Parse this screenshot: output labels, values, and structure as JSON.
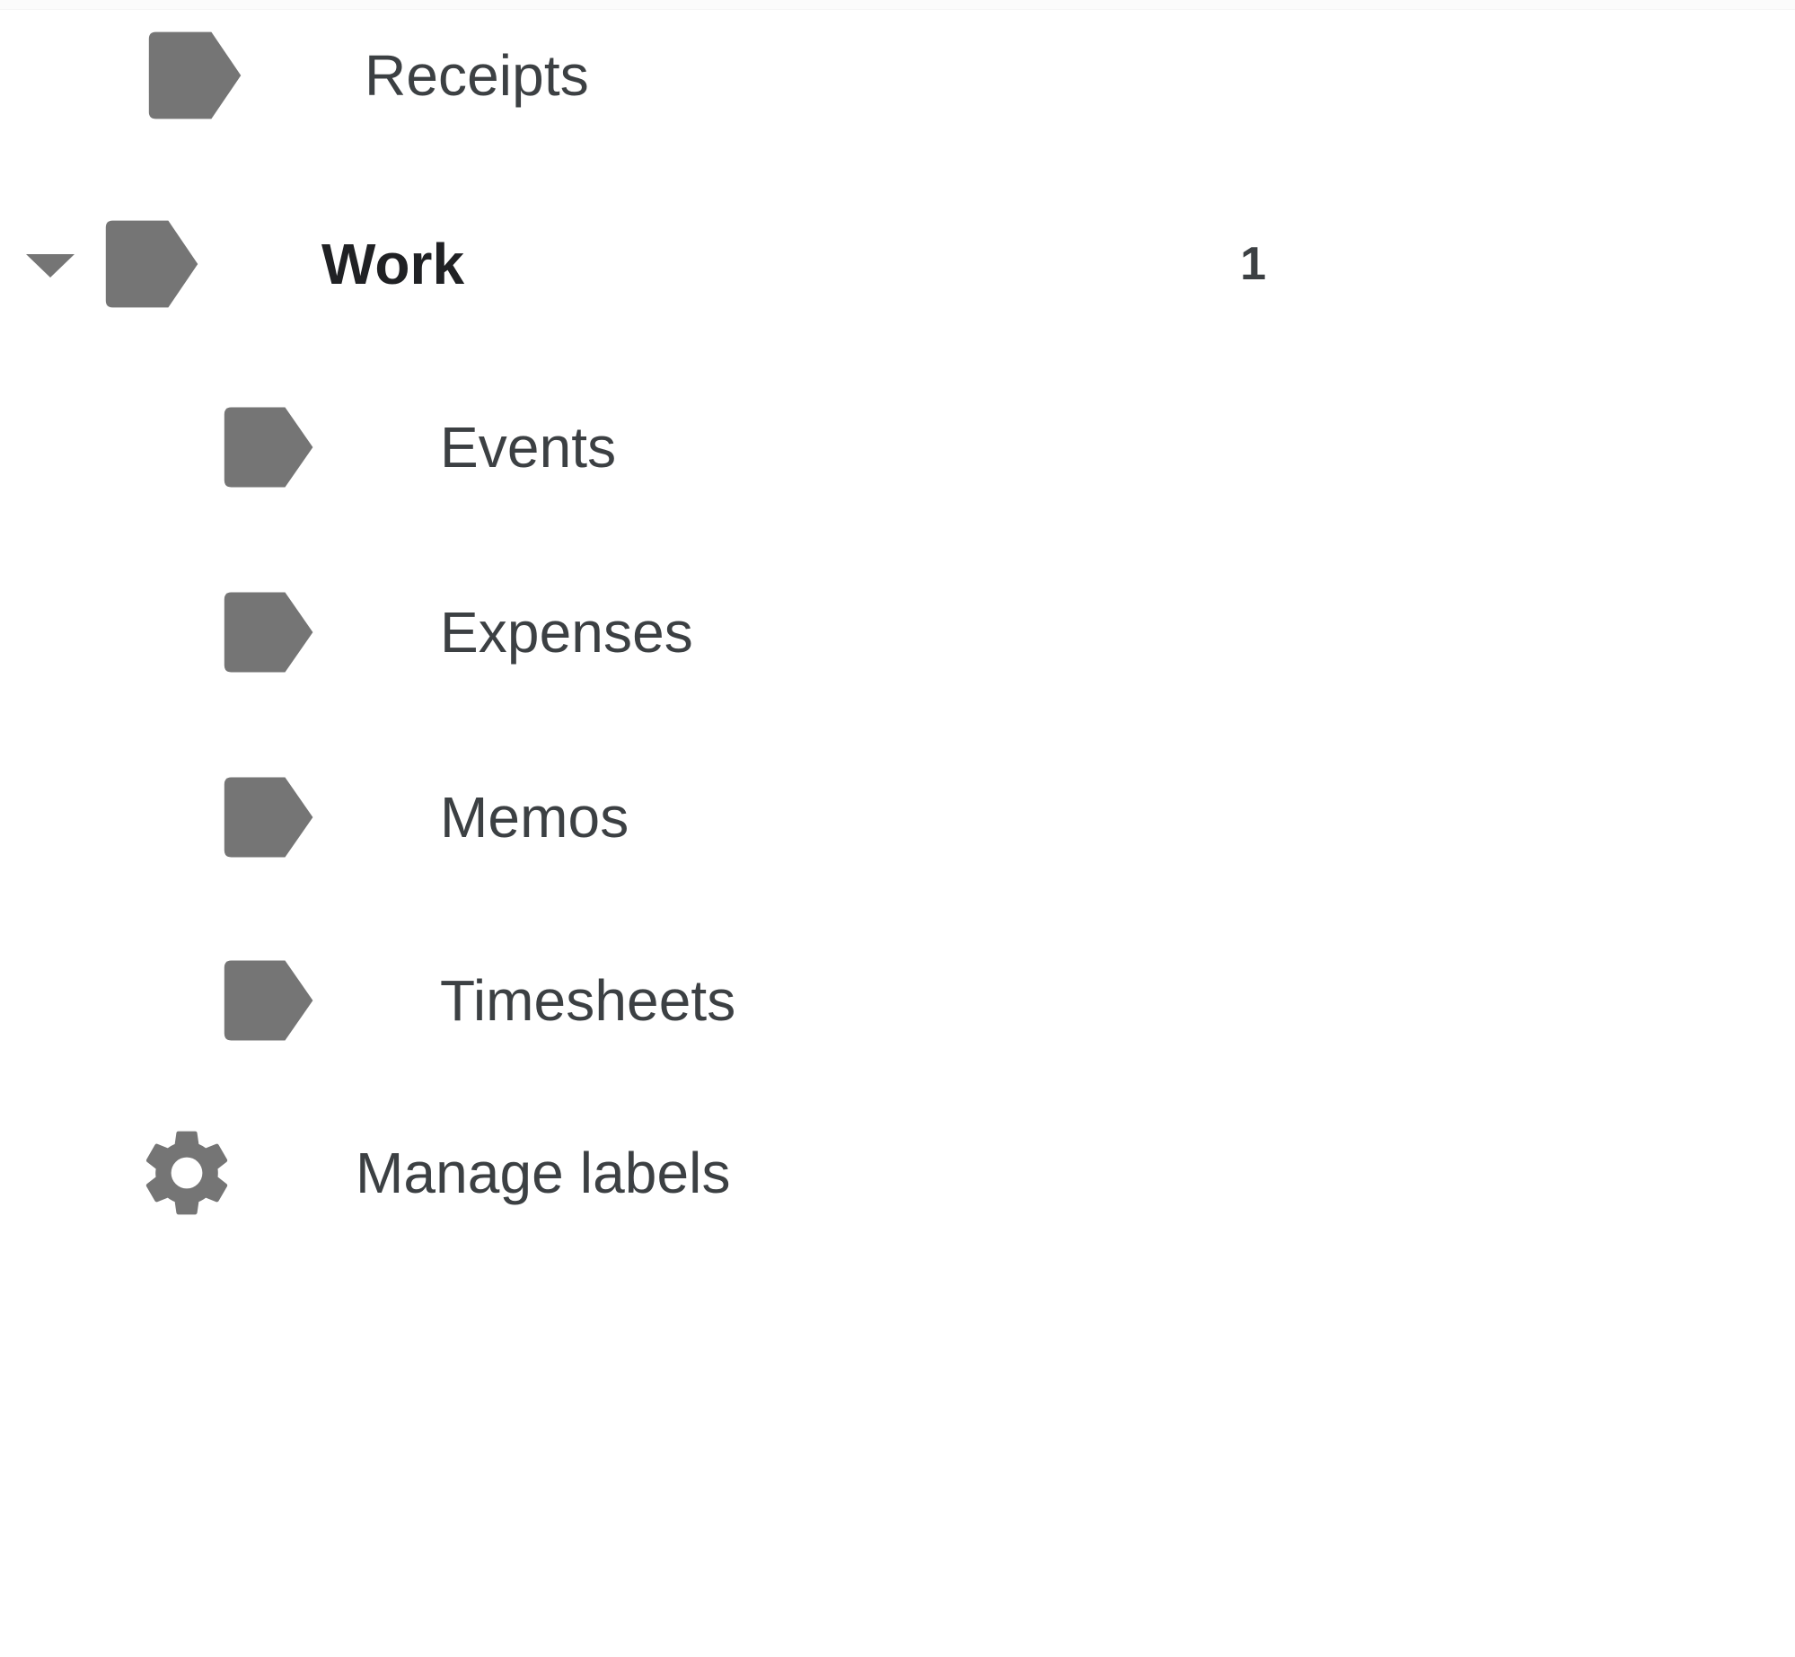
{
  "panel": {
    "name": "labels-sidebar"
  },
  "colors": {
    "icon_gray": "#757575",
    "text_primary": "#202124",
    "text_secondary": "#3c4043",
    "background": "#ffffff"
  },
  "rows": [
    {
      "id": "receipts",
      "label": "Receipts",
      "icon": "label-tag-icon",
      "level": 1,
      "bold": false,
      "count": "",
      "expandable": false
    },
    {
      "id": "work",
      "label": "Work",
      "icon": "label-tag-icon",
      "level": 1,
      "bold": true,
      "count": "1",
      "expandable": true,
      "expanded": true,
      "disclosure_icon": "caret-down-icon"
    },
    {
      "id": "events",
      "label": "Events",
      "icon": "label-tag-icon",
      "level": 2,
      "bold": false,
      "count": "",
      "expandable": false
    },
    {
      "id": "expenses",
      "label": "Expenses",
      "icon": "label-tag-icon",
      "level": 2,
      "bold": false,
      "count": "",
      "expandable": false
    },
    {
      "id": "memos",
      "label": "Memos",
      "icon": "label-tag-icon",
      "level": 2,
      "bold": false,
      "count": "",
      "expandable": false
    },
    {
      "id": "timesheets",
      "label": "Timesheets",
      "icon": "label-tag-icon",
      "level": 2,
      "bold": false,
      "count": "",
      "expandable": false
    }
  ],
  "manage": {
    "label": "Manage labels",
    "icon": "gear-icon"
  }
}
